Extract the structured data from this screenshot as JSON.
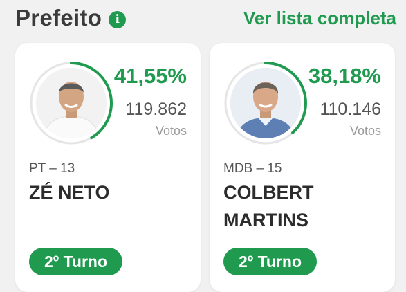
{
  "header": {
    "title": "Prefeito",
    "info_icon": "info-icon",
    "see_all_label": "Ver lista completa"
  },
  "colors": {
    "accent": "#1f9a4f",
    "ring_track": "#e5e5e5"
  },
  "candidates": [
    {
      "percent_label": "41,55%",
      "percent_value": 41.55,
      "votes": "119.862",
      "votes_label": "Votos",
      "party": "PT – 13",
      "name": "ZÉ NETO",
      "round_label": "2º Turno"
    },
    {
      "percent_label": "38,18%",
      "percent_value": 38.18,
      "votes": "110.146",
      "votes_label": "Votos",
      "party": "MDB – 15",
      "name": "COLBERT MARTINS",
      "round_label": "2º Turno"
    }
  ]
}
